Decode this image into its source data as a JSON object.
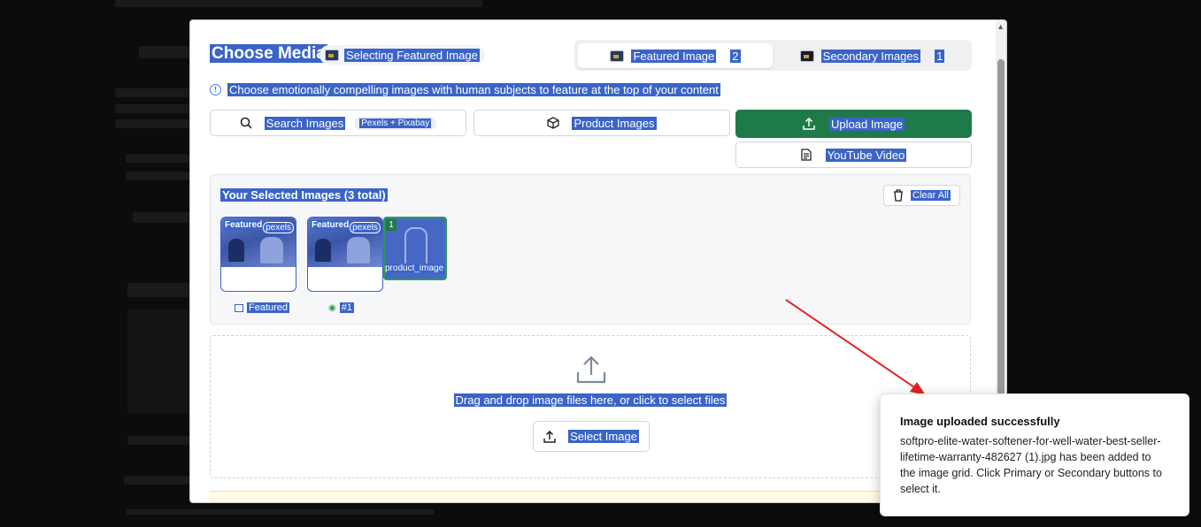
{
  "modal": {
    "title": "Choose Media",
    "selecting_badge": "Selecting Featured Image",
    "tabs": [
      {
        "label": "Featured Image",
        "count": "2"
      },
      {
        "label": "Secondary Images",
        "count": "1"
      }
    ],
    "hint": "Choose emotionally compelling images with human subjects to feature at the top of your content",
    "actions": {
      "search_label": "Search Images",
      "search_sources": "Pexels + Pixabay",
      "product_label": "Product Images",
      "upload_label": "Upload Image",
      "youtube_label": "YouTube Video"
    },
    "selected": {
      "title": "Your Selected Images (3 total)",
      "clear_label": "Clear All",
      "items": [
        {
          "tag": "Featured",
          "source": "pexels",
          "caption": "Featured"
        },
        {
          "tag": "Featured",
          "source": "pexels",
          "caption": "#1"
        },
        {
          "tag": "1",
          "source": "product_image",
          "caption": ""
        }
      ]
    },
    "dropzone": {
      "text": "Drag and drop image files here, or click to select files",
      "button": "Select Image"
    }
  },
  "toast": {
    "title": "Image uploaded successfully",
    "body": "softpro-elite-water-softener-for-well-water-best-seller-lifetime-warranty-482627 (1).jpg has been added to the image grid. Click Primary or Secondary buttons to select it."
  },
  "colors": {
    "accent_green": "#1f7a4a",
    "selection_blue": "#3b64c8",
    "annotation_arrow": "#e32222"
  }
}
